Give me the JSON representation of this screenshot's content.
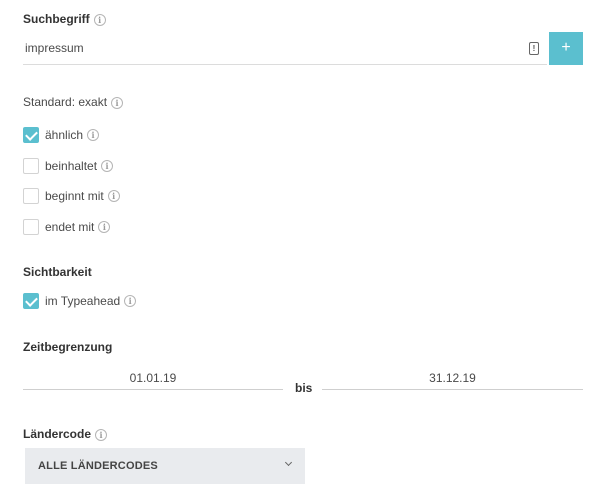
{
  "search": {
    "heading": "Suchbegriff",
    "value": "impressum",
    "add_label": "+"
  },
  "match": {
    "heading": "Standard: exakt",
    "options": [
      {
        "label": "ähnlich",
        "checked": true
      },
      {
        "label": "beinhaltet",
        "checked": false
      },
      {
        "label": "beginnt mit",
        "checked": false
      },
      {
        "label": "endet mit",
        "checked": false
      }
    ]
  },
  "visibility": {
    "heading": "Sichtbarkeit",
    "option": {
      "label": "im Typeahead",
      "checked": true
    }
  },
  "time": {
    "heading": "Zeitbegrenzung",
    "from": "01.01.19",
    "separator": "bis",
    "to": "31.12.19"
  },
  "country": {
    "heading": "Ländercode",
    "selected": "ALLE LÄNDERCODES"
  },
  "colors": {
    "accent": "#5bbfcf",
    "select_bg": "#e9ebee"
  },
  "icons": [
    "info-icon",
    "clipboard-icon",
    "plus-icon",
    "checkmark-icon",
    "chevron-down-icon"
  ]
}
